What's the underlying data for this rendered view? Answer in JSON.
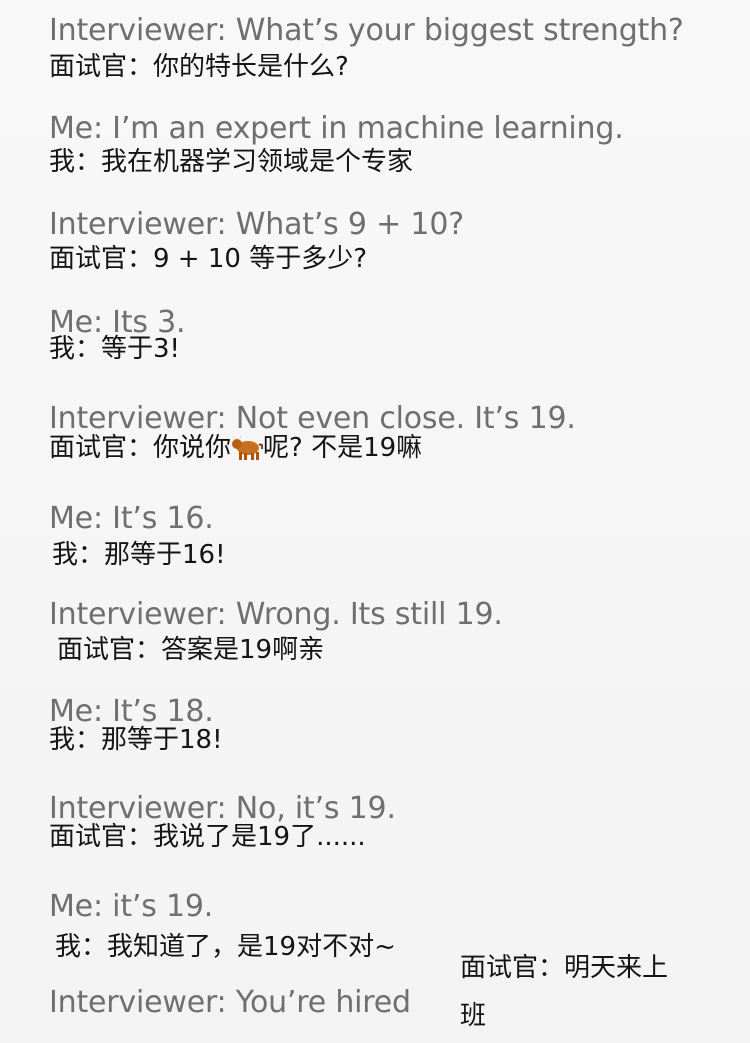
{
  "lines": [
    {
      "en": "Interviewer: What’s your biggest strength?",
      "zh": "面试官：你的特长是什么?"
    },
    {
      "en": "Me: I’m an expert in machine learning.",
      "zh": "我：我在机器学习领域是个专家"
    },
    {
      "en": "Interviewer: What’s 9 + 10?",
      "zh": "面试官：9 + 10 等于多少?"
    },
    {
      "en": "Me: Its 3.",
      "zh": "我：等于3!"
    },
    {
      "en": "Interviewer: Not even close. It’s 19.",
      "zh_before": "面试官：你说你",
      "zh_after": "呢? 不是19嘛"
    },
    {
      "en": "Me: It’s 16.",
      "zh": "我：那等于16!"
    },
    {
      "en": "Interviewer: Wrong. Its still 19.",
      "zh": "面试官：答案是19啊亲"
    },
    {
      "en": "Me: It’s 18.",
      "zh": "我：那等于18!"
    },
    {
      "en": "Interviewer: No, it’s 19.",
      "zh": "面试官：我说了是19了......"
    },
    {
      "en": "Me: it’s 19.",
      "zh": "我：我知道了，是19对不对~"
    },
    {
      "en": "Interviewer: You’re hired",
      "zh_line1": "面试官：明天来上",
      "zh_line2": "班"
    }
  ],
  "icons": {
    "bull": "bull-emoji-icon"
  },
  "colors": {
    "english": "#6f6f6f",
    "chinese": "#141414",
    "background": "#f6f6f6"
  }
}
